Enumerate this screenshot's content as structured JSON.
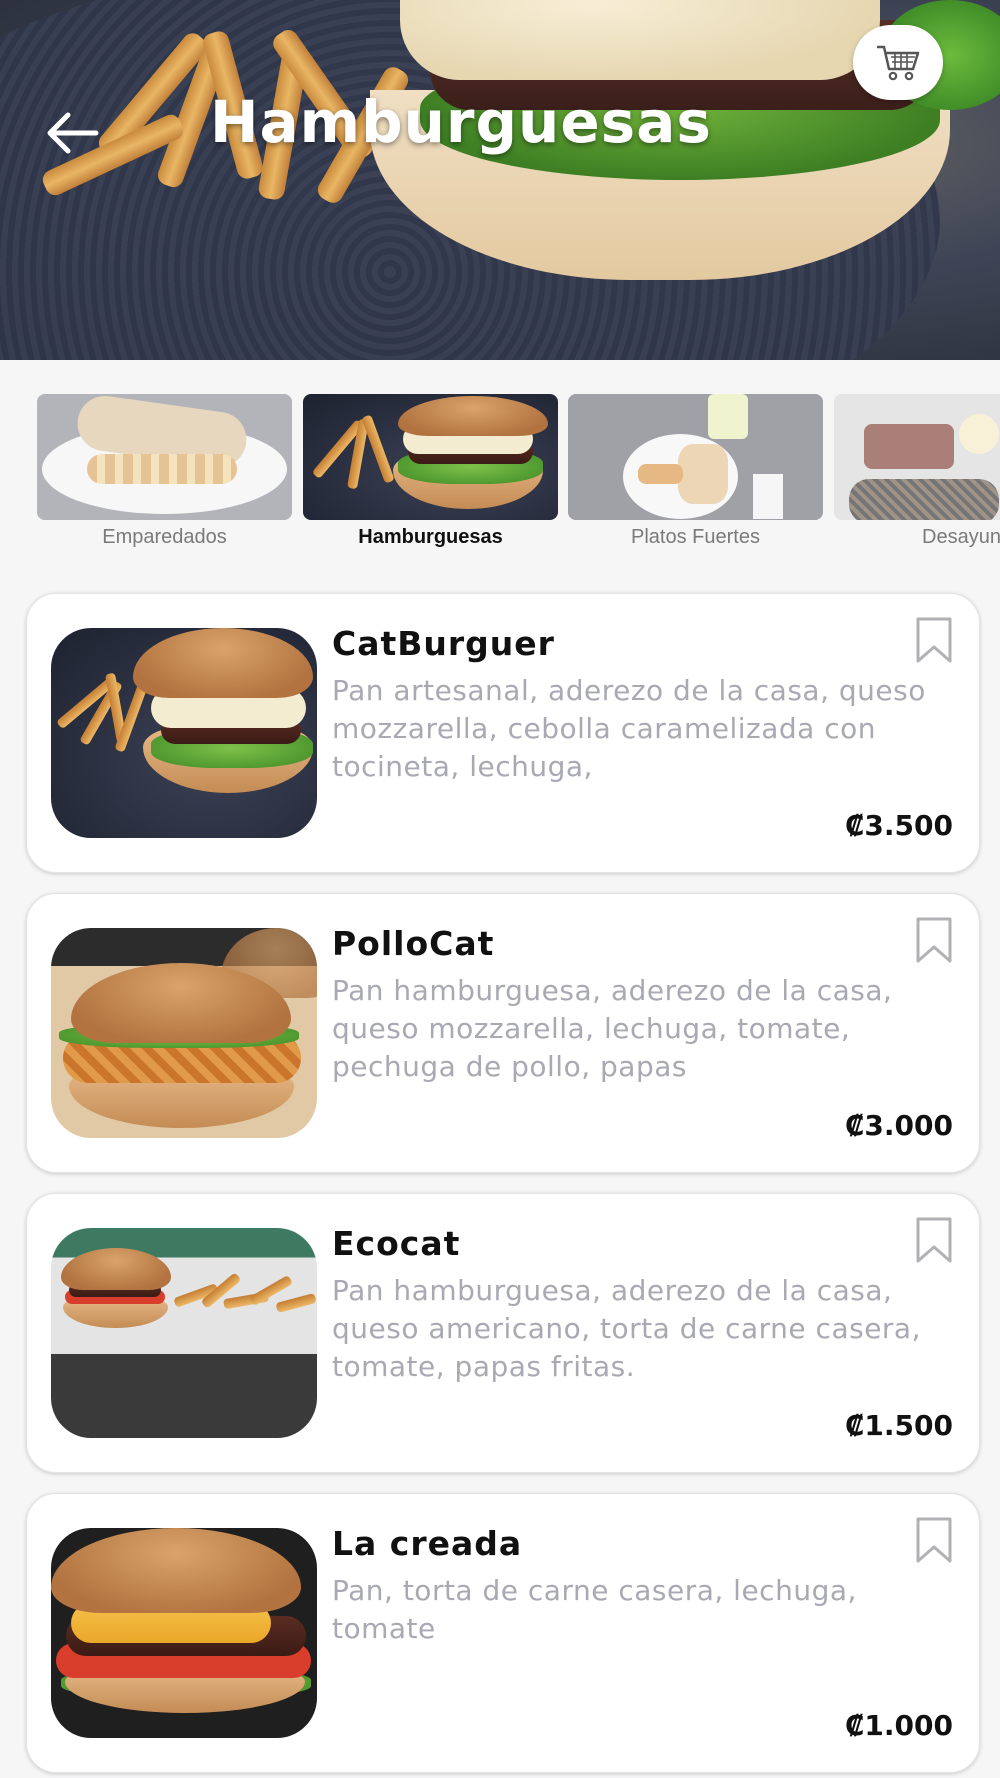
{
  "header": {
    "title": "Hamburguesas"
  },
  "icons": {
    "back": "arrow-left-icon",
    "cart": "shopping-cart-icon",
    "bookmark": "bookmark-icon"
  },
  "categories": [
    {
      "label": "Emparedados",
      "active": false
    },
    {
      "label": "Hamburguesas",
      "active": true
    },
    {
      "label": "Platos Fuertes",
      "active": false
    },
    {
      "label": "Desayun",
      "active": false
    }
  ],
  "products": [
    {
      "name": "CatBurguer",
      "description": "Pan artesanal, aderezo de la casa, queso mozzarella, cebolla caramelizada con tocineta, lechuga,",
      "price": "₡3.500"
    },
    {
      "name": "PolloCat",
      "description": "Pan hamburguesa, aderezo de la casa, queso mozzarella, lechuga, tomate, pechuga de pollo, papas",
      "price": "₡3.000"
    },
    {
      "name": "Ecocat",
      "description": "Pan hamburguesa, aderezo de la casa, queso americano, torta de carne casera, tomate, papas fritas.",
      "price": "₡1.500"
    },
    {
      "name": "La creada",
      "description": "Pan, torta de carne casera, lechuga, tomate",
      "price": "₡1.000"
    }
  ],
  "colors": {
    "background": "#f6f6f7",
    "card": "#ffffff",
    "text_primary": "#111111",
    "text_secondary": "#a9a9b3"
  }
}
